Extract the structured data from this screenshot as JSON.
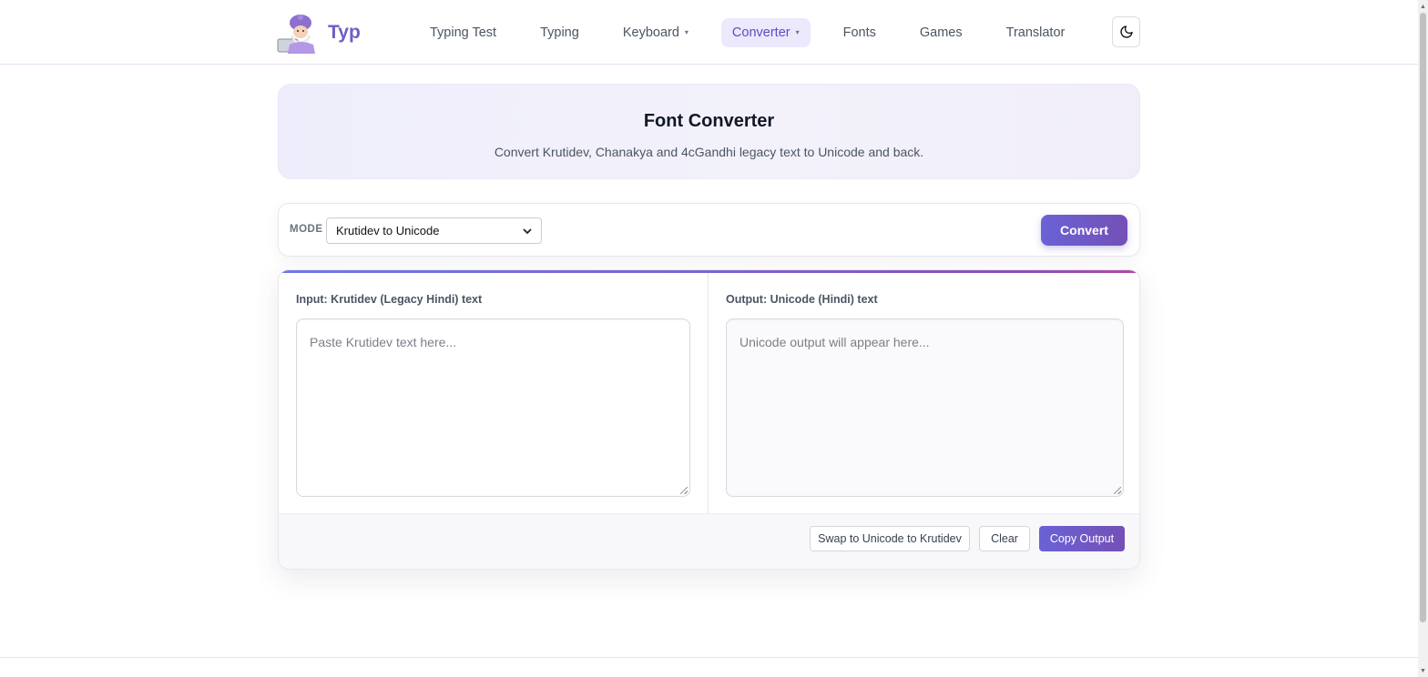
{
  "brand": {
    "name": "Typ"
  },
  "nav": {
    "items": [
      {
        "label": "Typing Test",
        "dropdown": false,
        "active": false
      },
      {
        "label": "Typing",
        "dropdown": false,
        "active": false
      },
      {
        "label": "Keyboard",
        "dropdown": true,
        "active": false
      },
      {
        "label": "Converter",
        "dropdown": true,
        "active": true
      },
      {
        "label": "Fonts",
        "dropdown": false,
        "active": false
      },
      {
        "label": "Games",
        "dropdown": false,
        "active": false
      },
      {
        "label": "Translator",
        "dropdown": false,
        "active": false
      }
    ],
    "caret": "▾"
  },
  "hero": {
    "title": "Font Converter",
    "subtitle": "Convert Krutidev, Chanakya and 4cGandhi legacy text to Unicode and back."
  },
  "toolbar": {
    "mode_label": "MODE",
    "mode_selected": "Krutidev to Unicode",
    "convert_label": "Convert"
  },
  "input": {
    "label": "Input: Krutidev (Legacy Hindi) text",
    "placeholder": "Paste Krutidev text here..."
  },
  "output": {
    "label": "Output: Unicode (Hindi) text",
    "placeholder": "Unicode output will appear here..."
  },
  "actions": {
    "swap_label": "Swap to Unicode to Krutidev",
    "clear_label": "Clear",
    "copy_label": "Copy Output"
  },
  "colors": {
    "accent": "#6b5fc4",
    "button_gradient_start": "#6a62d6",
    "button_gradient_end": "#7450b6",
    "active_nav_bg": "#ebe9fb"
  }
}
